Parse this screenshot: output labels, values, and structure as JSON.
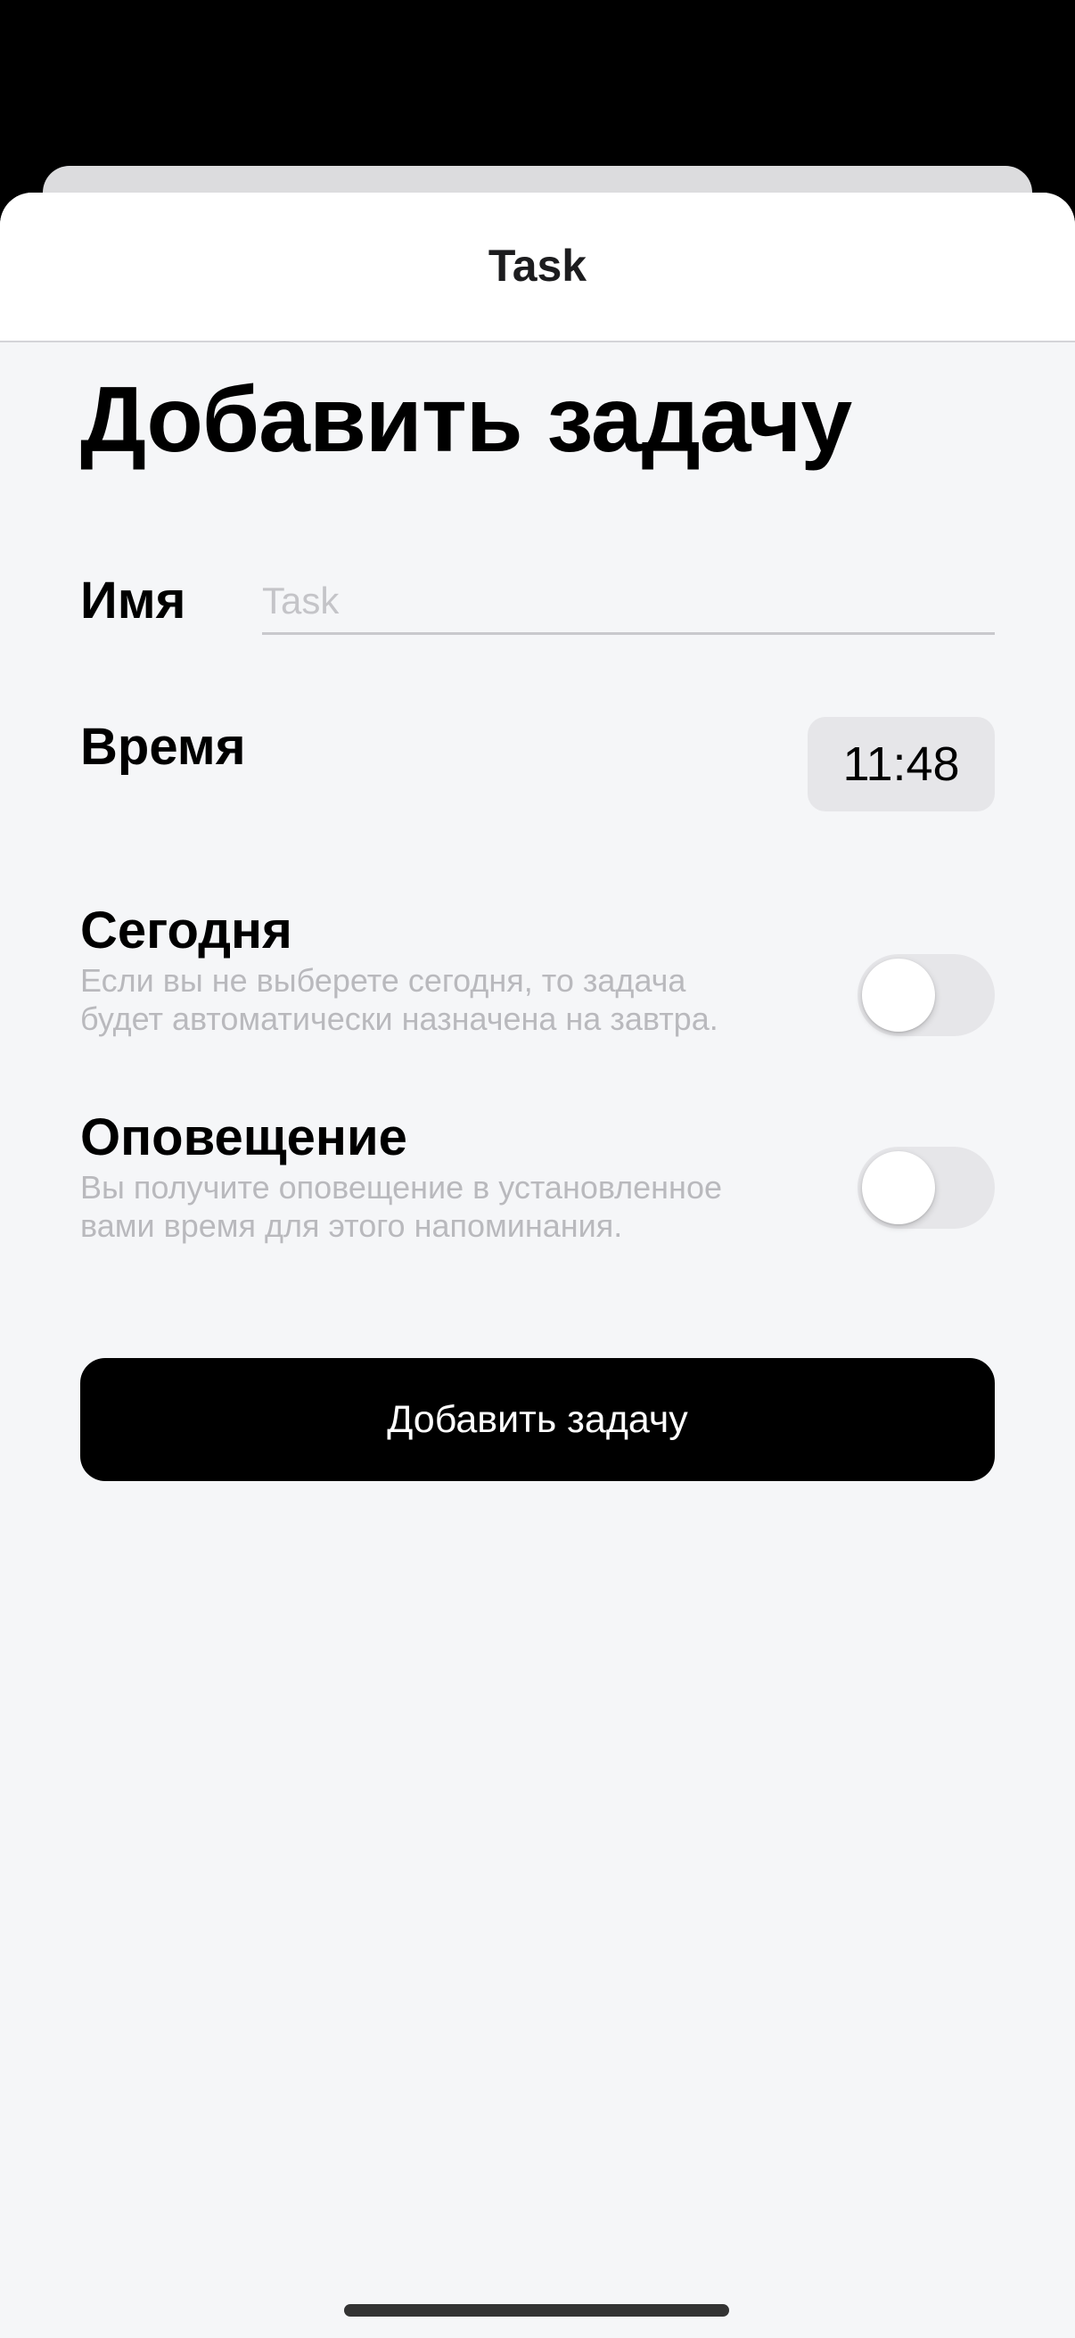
{
  "nav": {
    "title": "Task"
  },
  "form": {
    "title": "Добавить задачу",
    "name": {
      "label": "Имя",
      "value": "",
      "placeholder": "Task"
    },
    "time": {
      "label": "Время",
      "value": "11:48"
    },
    "today": {
      "label": "Сегодня",
      "description": "Если вы не выберете сегодня, то задача будет автоматически назначена на завтра.",
      "enabled": false
    },
    "notification": {
      "label": "Оповещение",
      "description": "Вы получите оповещение в установленное вами время для этого напоминания.",
      "enabled": false
    },
    "submit_label": "Добавить задачу"
  },
  "colors": {
    "background": "#000000",
    "sheet": "#f5f6f8",
    "accent": "#000000",
    "toggle_off": "#e6e6e9",
    "secondary_text": "#b9b9bd"
  }
}
